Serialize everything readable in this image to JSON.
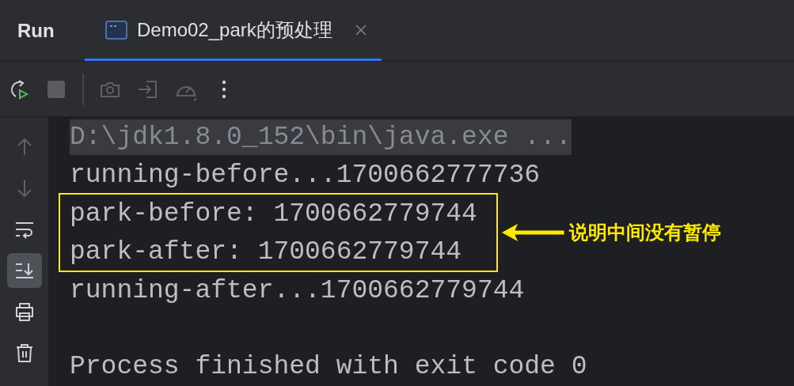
{
  "tool_window": {
    "title": "Run",
    "tabs": [
      {
        "label": "Demo02_park的预处理",
        "selected": true
      }
    ]
  },
  "toolbar": [
    {
      "kind": "rerun",
      "disabled": false
    },
    {
      "kind": "stop",
      "disabled": true
    },
    {
      "kind": "separator"
    },
    {
      "kind": "camera",
      "disabled": true
    },
    {
      "kind": "enter",
      "disabled": true
    },
    {
      "kind": "gauge",
      "disabled": true
    },
    {
      "kind": "more",
      "disabled": false
    }
  ],
  "sidebar": [
    {
      "kind": "up",
      "disabled": true,
      "selected": false
    },
    {
      "kind": "down",
      "disabled": true,
      "selected": false
    },
    {
      "kind": "wrap",
      "disabled": false,
      "selected": false
    },
    {
      "kind": "scroll",
      "disabled": false,
      "selected": true
    },
    {
      "kind": "print",
      "disabled": false,
      "selected": false
    },
    {
      "kind": "trash",
      "disabled": false,
      "selected": false
    }
  ],
  "console": {
    "lines": [
      {
        "kind": "command",
        "text": "D:\\jdk1.8.0_152\\bin\\java.exe ...",
        "boxed": false
      },
      {
        "kind": "output",
        "text": "running-before...1700662777736",
        "boxed": false
      },
      {
        "kind": "output",
        "text": "park-before: 1700662779744",
        "boxed": true
      },
      {
        "kind": "output",
        "text": "park-after: 1700662779744",
        "boxed": true
      },
      {
        "kind": "output",
        "text": "running-after...1700662779744",
        "boxed": false
      },
      {
        "kind": "blank",
        "boxed": false
      },
      {
        "kind": "output",
        "text": "Process finished with exit code 0",
        "boxed": false
      }
    ],
    "annotation": {
      "text": "说明中间没有暂停"
    }
  }
}
